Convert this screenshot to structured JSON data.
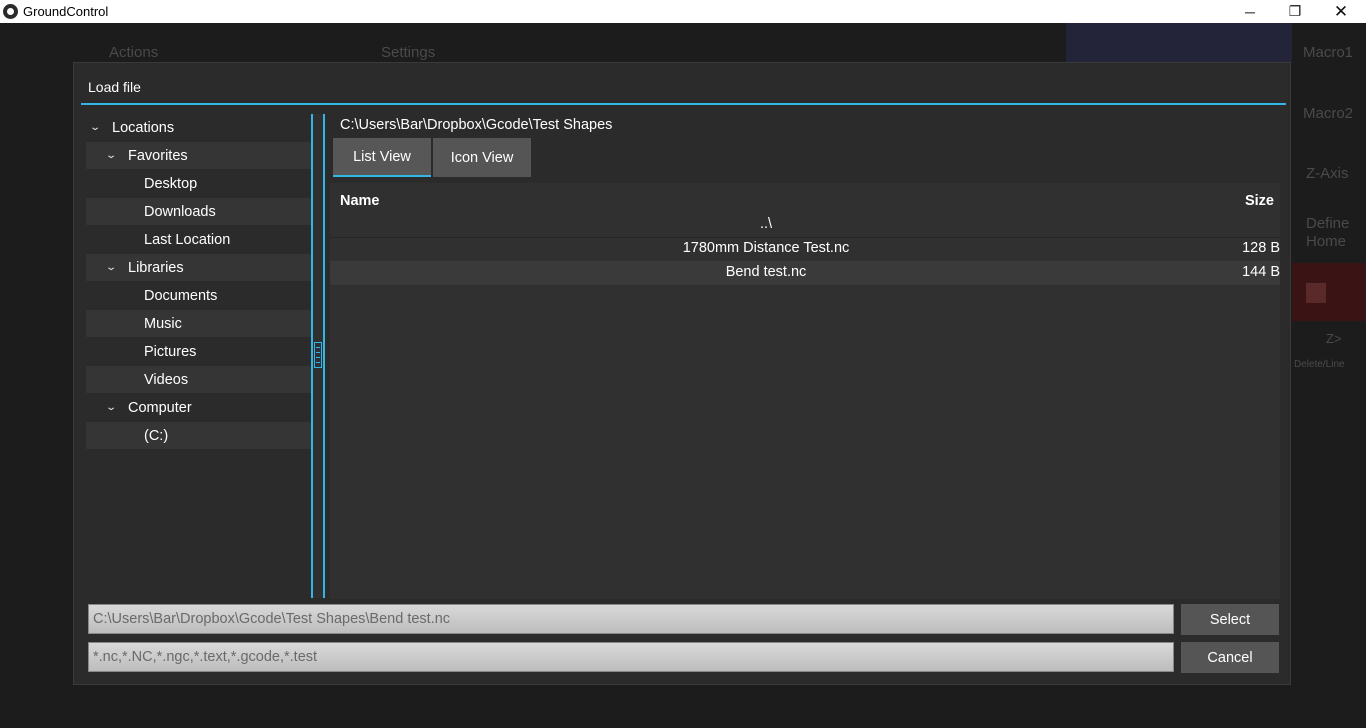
{
  "window": {
    "title": "GroundControl",
    "minimize_glyph": "─",
    "maximize_glyph": "❐",
    "close_glyph": "✕"
  },
  "background": {
    "actions_label": "Actions",
    "settings_label": "Settings",
    "macro1_label": "Macro1",
    "macro2_label": "Macro2",
    "zaxis_label": "Z-Axis",
    "define_label": "Define",
    "home_label": "Home",
    "zgt_label": "Z>",
    "deleteline_label": "Delete/Line"
  },
  "dialog": {
    "title": "Load file",
    "accent_color": "#33b5e5",
    "tree": [
      {
        "label": "Locations",
        "level": 0,
        "expandable": true
      },
      {
        "label": "Favorites",
        "level": 1,
        "expandable": true
      },
      {
        "label": "Desktop",
        "level": 2,
        "expandable": false
      },
      {
        "label": "Downloads",
        "level": 2,
        "expandable": false
      },
      {
        "label": "Last Location",
        "level": 2,
        "expandable": false
      },
      {
        "label": "Libraries",
        "level": 1,
        "expandable": true
      },
      {
        "label": "Documents",
        "level": 2,
        "expandable": false
      },
      {
        "label": "Music",
        "level": 2,
        "expandable": false
      },
      {
        "label": "Pictures",
        "level": 2,
        "expandable": false
      },
      {
        "label": "Videos",
        "level": 2,
        "expandable": false
      },
      {
        "label": "Computer",
        "level": 1,
        "expandable": true
      },
      {
        "label": "(C:)",
        "level": 2,
        "expandable": false
      }
    ],
    "current_path": "C:\\Users\\Bar\\Dropbox\\Gcode\\Test Shapes",
    "tabs": {
      "list_view": "List View",
      "icon_view": "Icon View",
      "active": "list_view"
    },
    "filelist": {
      "columns": {
        "name": "Name",
        "size": "Size"
      },
      "rows": [
        {
          "name": "..\\",
          "size": ""
        },
        {
          "name": "1780mm Distance Test.nc",
          "size": "128 B"
        },
        {
          "name": "Bend test.nc",
          "size": "144 B"
        }
      ]
    },
    "selected_file_value": "C:\\Users\\Bar\\Dropbox\\Gcode\\Test Shapes\\Bend test.nc",
    "filter_value": "*.nc,*.NC,*.ngc,*.text,*.gcode,*.test",
    "select_label": "Select",
    "cancel_label": "Cancel"
  }
}
